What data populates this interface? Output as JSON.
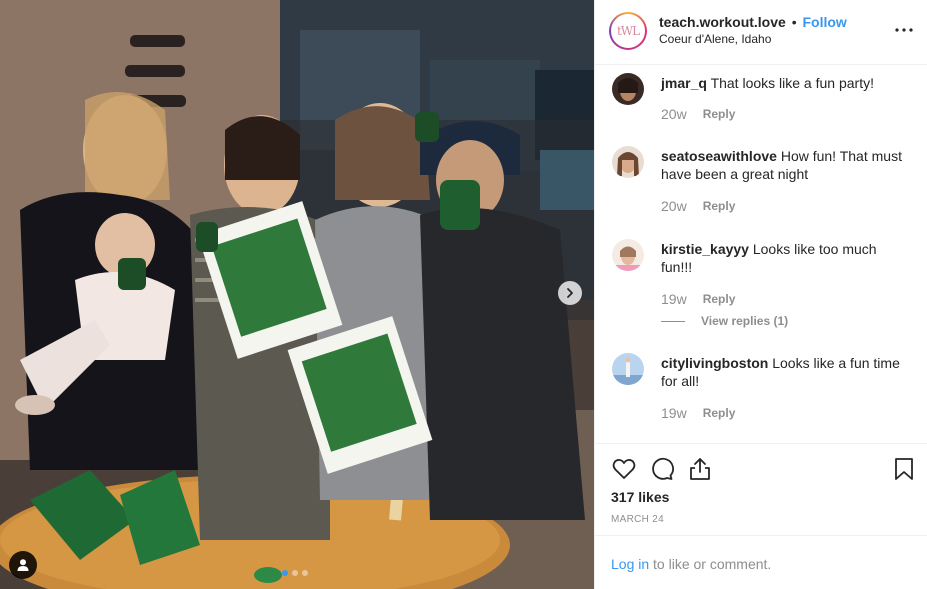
{
  "post": {
    "username": "teach.workout.love",
    "separator": "•",
    "follow_label": "Follow",
    "location": "Coeur d'Alene, Idaho",
    "avatar_monogram": "tWL",
    "more_icon": "more-options-icon"
  },
  "photo": {
    "carousel_total": 3,
    "carousel_active": 1
  },
  "comments": [
    {
      "username": "jmar_q",
      "text": "That looks like a fun party!",
      "time": "20w",
      "reply_label": "Reply",
      "avatar_color": "#6b4a3f"
    },
    {
      "username": "seatoseawithlove",
      "text": "How fun! That must have been a great night",
      "time": "20w",
      "reply_label": "Reply",
      "avatar_color": "#a77a5c"
    },
    {
      "username": "kirstie_kayyy",
      "text": "Looks like too much fun!!!",
      "time": "19w",
      "reply_label": "Reply",
      "view_replies": "View replies (1)",
      "avatar_color": "#e7c7b6"
    },
    {
      "username": "citylivingboston",
      "text": "Looks like a fun time for all!",
      "time": "19w",
      "reply_label": "Reply",
      "avatar_color": "#9fc3e6"
    }
  ],
  "actions": {
    "like_icon": "heart-icon",
    "comment_icon": "comment-icon",
    "share_icon": "share-icon",
    "save_icon": "bookmark-icon",
    "likes": "317 likes",
    "date": "MARCH 24"
  },
  "login": {
    "link_label": "Log in",
    "suffix": " to like or comment."
  },
  "colors": {
    "accent": "#3897f0",
    "secondary_text": "#8e8e8e",
    "border": "#efefef"
  }
}
